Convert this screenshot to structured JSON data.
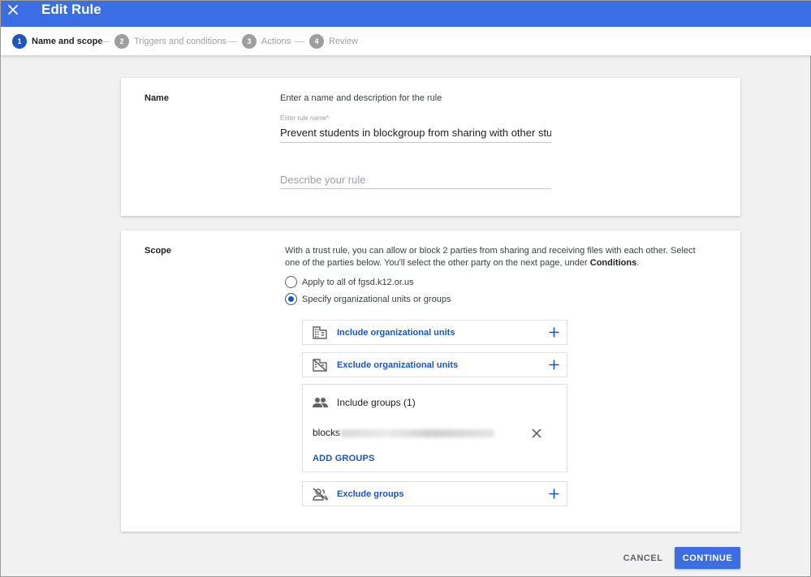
{
  "header": {
    "title": "Edit Rule",
    "close_icon": "close-icon"
  },
  "stepper": {
    "steps": [
      {
        "number": "1",
        "label": "Name and scope",
        "state": "active"
      },
      {
        "number": "2",
        "label": "Triggers and conditions",
        "state": "inactive"
      },
      {
        "number": "3",
        "label": "Actions",
        "state": "inactive"
      },
      {
        "number": "4",
        "label": "Review",
        "state": "inactive"
      }
    ]
  },
  "name_section": {
    "label": "Name",
    "hint": "Enter a name and description for the rule",
    "rule_name_label": "Enter rule name*",
    "rule_name_value": "Prevent students in blockgroup from sharing with other student",
    "description_placeholder": "Describe your rule",
    "description_value": ""
  },
  "scope_section": {
    "label": "Scope",
    "description_before": "With a trust rule, you can allow or block 2 parties from sharing and receiving files with each other. Select one of the parties below. You'll select the other party on the next page, under ",
    "description_bold": "Conditions",
    "description_after": ".",
    "options": [
      {
        "label": "Apply to all of fgsd.k12.or.us",
        "checked": false
      },
      {
        "label": "Specify organizational units or groups",
        "checked": true
      }
    ],
    "include_ou_label": "Include organizational units",
    "exclude_ou_label": "Exclude organizational units",
    "include_groups_label": "Include groups (1)",
    "group_entry_prefix": "blocks",
    "add_groups_label": "ADD GROUPS",
    "exclude_groups_label": "Exclude groups"
  },
  "footer": {
    "cancel_label": "CANCEL",
    "continue_label": "CONTINUE"
  },
  "colors": {
    "header_bg": "#3b6ee4",
    "accent": "#1a56c4",
    "inactive": "#9e9e9e"
  }
}
